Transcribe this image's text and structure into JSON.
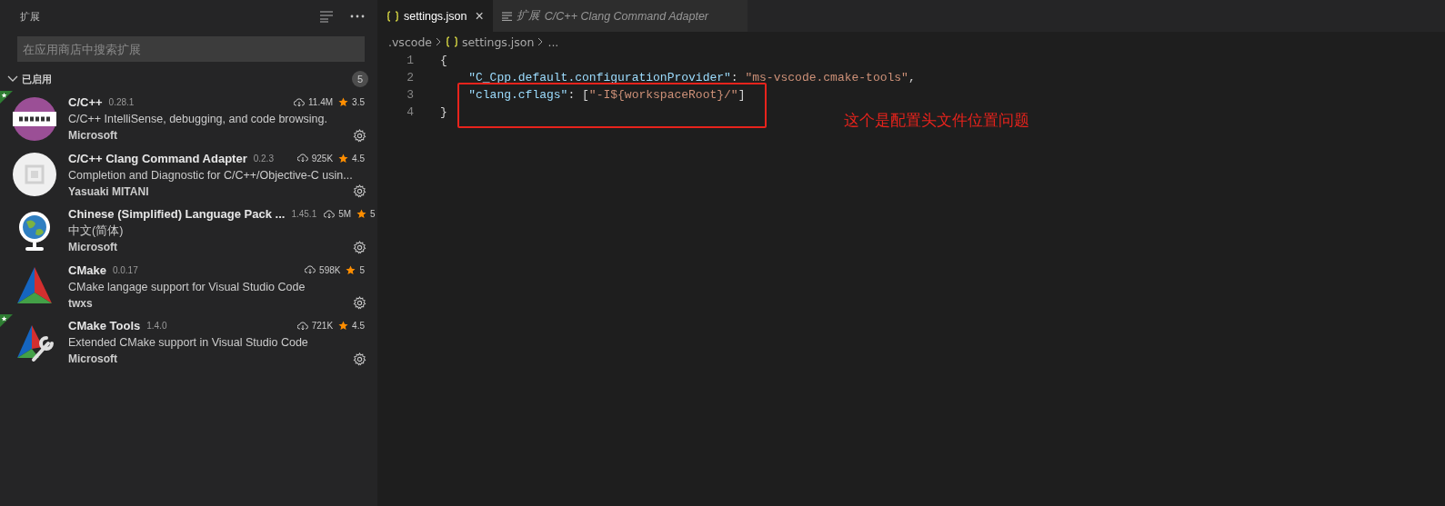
{
  "sidebar": {
    "title": "扩展",
    "search": {
      "placeholder": "在应用商店中搜索扩展"
    },
    "section": {
      "label": "已启用",
      "expanded": true,
      "count": "5"
    },
    "extensions": [
      {
        "kind": "cpp",
        "name": "C/C++",
        "version": "0.28.1",
        "downloads": "11.4M",
        "rating": "3.5",
        "description": "C/C++ IntelliSense, debugging, and code browsing.",
        "publisher": "Microsoft",
        "featured": true
      },
      {
        "kind": "clang",
        "name": "C/C++ Clang Command Adapter",
        "version": "0.2.3",
        "downloads": "925K",
        "rating": "4.5",
        "description": "Completion and Diagnostic for C/C++/Objective-C usin...",
        "publisher": "Yasuaki MITANI",
        "featured": false
      },
      {
        "kind": "globe",
        "name": "Chinese (Simplified) Language Pack ...",
        "version": "1.45.1",
        "downloads": "5M",
        "rating": "5",
        "description": "中文(简体)",
        "publisher": "Microsoft",
        "featured": false
      },
      {
        "kind": "cmake",
        "name": "CMake",
        "version": "0.0.17",
        "downloads": "598K",
        "rating": "5",
        "description": "CMake langage support for Visual Studio Code",
        "publisher": "twxs",
        "featured": false
      },
      {
        "kind": "cmake-tools",
        "name": "CMake Tools",
        "version": "1.4.0",
        "downloads": "721K",
        "rating": "4.5",
        "description": "Extended CMake support in Visual Studio Code",
        "publisher": "Microsoft",
        "featured": true
      }
    ]
  },
  "tabs": [
    {
      "kind": "json",
      "label": "settings.json",
      "selected": true,
      "close": "×"
    },
    {
      "kind": "preview",
      "prefix": "扩展",
      "label": "C/C++ Clang Command Adapter",
      "selected": false
    }
  ],
  "breadcrumb": {
    "folder": ".vscode",
    "file": "settings.json",
    "rest": "..."
  },
  "code": [
    {
      "number": "1",
      "tokens": [
        {
          "kind": "punct",
          "text": "{"
        }
      ]
    },
    {
      "number": "2",
      "tokens": [
        {
          "kind": "key",
          "text": "    \"C_Cpp.default.configurationProvider\""
        },
        {
          "kind": "punct",
          "text": ": "
        },
        {
          "kind": "string",
          "text": "\"ms-vscode.cmake-tools\""
        },
        {
          "kind": "punct",
          "text": ","
        }
      ]
    },
    {
      "number": "3",
      "tokens": [
        {
          "kind": "key",
          "text": "    \"clang.cflags\""
        },
        {
          "kind": "punct",
          "text": ": ["
        },
        {
          "kind": "string",
          "text": "\"-I${workspaceRoot}/\""
        },
        {
          "kind": "punct",
          "text": "]"
        }
      ]
    },
    {
      "number": "4",
      "tokens": [
        {
          "kind": "punct",
          "text": "}"
        }
      ]
    }
  ],
  "annotation": {
    "text": "这个是配置头文件位置问题"
  }
}
